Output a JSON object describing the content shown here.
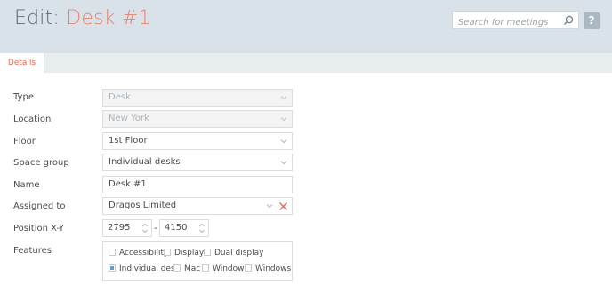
{
  "header": {
    "title_prefix": "Edit:",
    "title_name": "Desk #1",
    "search_placeholder": "Search for meetings",
    "help_label": "?"
  },
  "tabs": [
    {
      "label": "Details",
      "active": true
    }
  ],
  "form": {
    "type": {
      "label": "Type",
      "value": "Desk"
    },
    "location": {
      "label": "Location",
      "value": "New York"
    },
    "floor": {
      "label": "Floor",
      "value": "1st Floor"
    },
    "space_group": {
      "label": "Space group",
      "value": "Individual desks"
    },
    "name": {
      "label": "Name",
      "value": "Desk #1"
    },
    "assigned_to": {
      "label": "Assigned to",
      "value": "Dragos Limited"
    },
    "position": {
      "label": "Position X-Y",
      "x": "2795",
      "separator": "-",
      "y": "4150"
    },
    "features": {
      "label": "Features",
      "options": [
        {
          "label": "Accessibility",
          "checked": false
        },
        {
          "label": "Display",
          "checked": false
        },
        {
          "label": "Dual display",
          "checked": false
        },
        {
          "label": "Individual desk",
          "checked": true
        },
        {
          "label": "Mac",
          "checked": false
        },
        {
          "label": "Window",
          "checked": false
        },
        {
          "label": "Windows",
          "checked": false
        }
      ]
    }
  },
  "colors": {
    "accent": "#e8836f",
    "header_bg": "#d8e2e8",
    "checkbox_on": "#5b9fcf"
  }
}
